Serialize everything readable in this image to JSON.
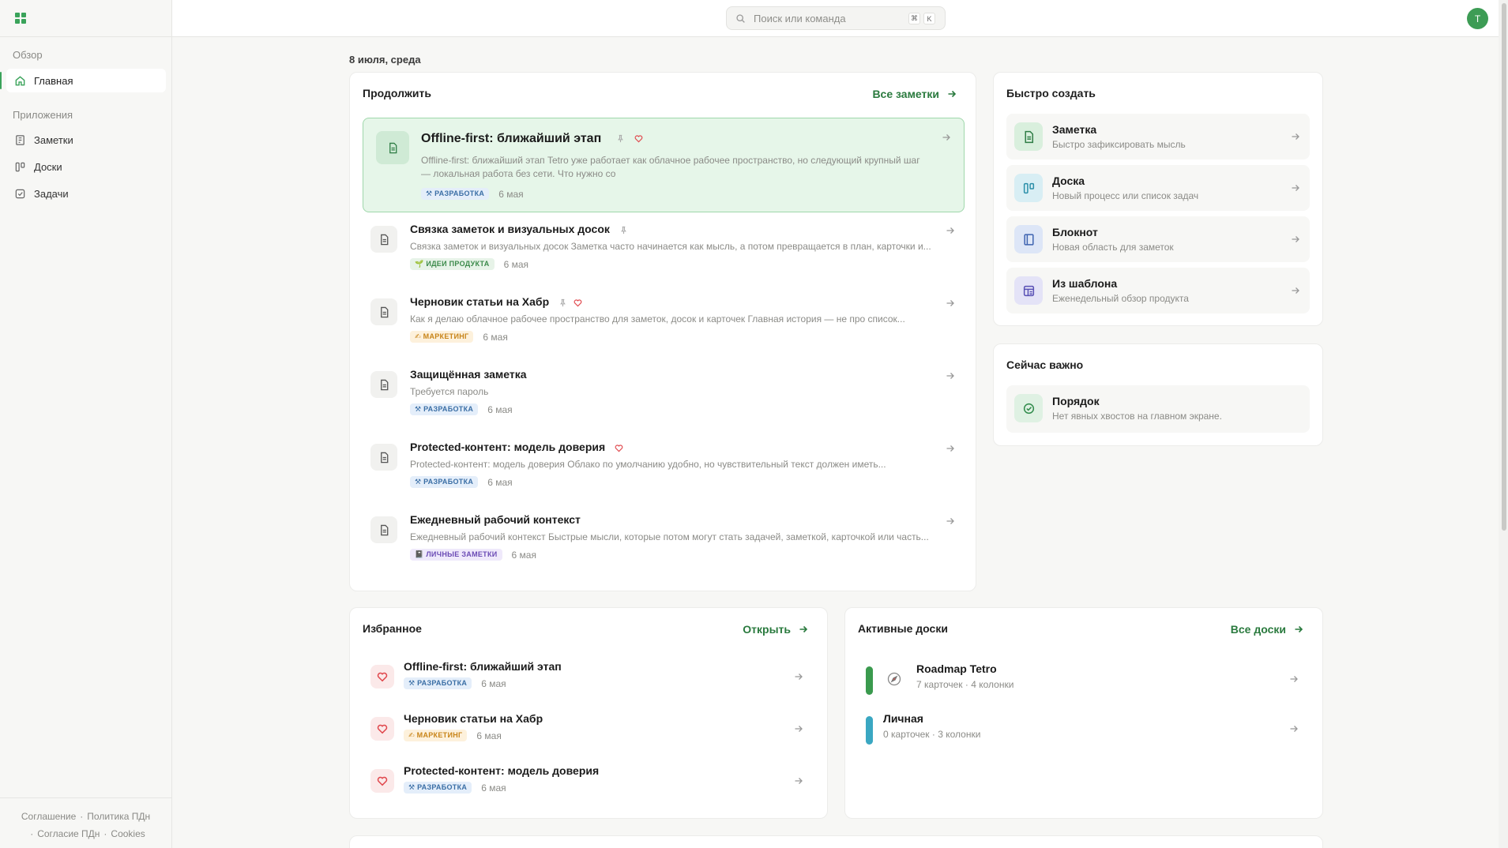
{
  "sidebar": {
    "section_overview": "Обзор",
    "home": "Главная",
    "section_apps": "Приложения",
    "notes": "Заметки",
    "boards": "Доски",
    "tasks": "Задачи",
    "footer": {
      "agreement": "Соглашение",
      "privacy": "Политика ПДн",
      "consent": "Согласие ПДн",
      "cookies": "Cookies"
    }
  },
  "topbar": {
    "search_placeholder": "Поиск или команда",
    "kbd_mod": "⌘",
    "kbd_key": "K",
    "avatar_letter": "T"
  },
  "date_label": "8 июля, среда",
  "continue": {
    "title": "Продолжить",
    "link": "Все заметки",
    "featured": {
      "title": "Offline-first: ближайший этап",
      "excerpt_line1": "Offline-first: ближайший этап Tetro уже работает как облачное рабочее пространство, но следующий крупный шаг",
      "excerpt_line2": "— локальная работа без сети. Что нужно со",
      "tag": "РАЗРАБОТКА",
      "date": "6 мая"
    },
    "items": [
      {
        "title": "Связка заметок и визуальных досок",
        "excerpt": "Связка заметок и визуальных досок Заметка часто начинается как мысль, а потом превращается в план, карточки и...",
        "tag": "ИДЕИ ПРОДУКТА",
        "tag_kind": "idea",
        "date": "6 мая"
      },
      {
        "title": "Черновик статьи на Хабр",
        "excerpt": "Как я делаю облачное рабочее пространство для заметок, досок и карточек Главная история — не про список...",
        "tag": "МАРКЕТИНГ",
        "tag_kind": "mkt",
        "date": "6 мая"
      },
      {
        "title": "Защищённая заметка",
        "excerpt": "Требуется пароль",
        "tag": "РАЗРАБОТКА",
        "tag_kind": "dev",
        "date": "6 мая"
      },
      {
        "title": "Protected-контент: модель доверия",
        "excerpt": "Protected-контент: модель доверия Облако по умолчанию удобно, но чувствительный текст должен иметь...",
        "tag": "РАЗРАБОТКА",
        "tag_kind": "dev",
        "date": "6 мая"
      },
      {
        "title": "Ежедневный рабочий контекст",
        "excerpt": "Ежедневный рабочий контекст Быстрые мысли, которые потом могут стать задачей, заметкой, карточкой или часть...",
        "tag": "ЛИЧНЫЕ ЗАМЕТКИ",
        "tag_kind": "pers",
        "date": "6 мая"
      }
    ]
  },
  "quick_create": {
    "title": "Быстро создать",
    "items": [
      {
        "title": "Заметка",
        "subtitle": "Быстро зафиксировать мысль"
      },
      {
        "title": "Доска",
        "subtitle": "Новый процесс или список задач"
      },
      {
        "title": "Блокнот",
        "subtitle": "Новая область для заметок"
      },
      {
        "title": "Из шаблона",
        "subtitle": "Еженедельный обзор продукта"
      }
    ]
  },
  "important": {
    "title": "Сейчас важно",
    "item_title": "Порядок",
    "item_subtitle": "Нет явных хвостов на главном экране."
  },
  "favorites": {
    "title": "Избранное",
    "link": "Открыть",
    "items": [
      {
        "title": "Offline-first: ближайший этап",
        "tag": "РАЗРАБОТКА",
        "tag_kind": "dev",
        "date": "6 мая"
      },
      {
        "title": "Черновик статьи на Хабр",
        "tag": "МАРКЕТИНГ",
        "tag_kind": "mkt",
        "date": "6 мая"
      },
      {
        "title": "Protected-контент: модель доверия",
        "tag": "РАЗРАБОТКА",
        "tag_kind": "dev",
        "date": "6 мая"
      }
    ]
  },
  "boards": {
    "title": "Активные доски",
    "link": "Все доски",
    "items": [
      {
        "title": "Roadmap Tetro",
        "meta": "7 карточек · 4 колонки",
        "color": "#3a9a4e"
      },
      {
        "title": "Личная",
        "meta": "0 карточек · 3 колонки",
        "color": "#3aa7c2"
      }
    ]
  },
  "colors": {
    "accent": "#3aa35a",
    "link": "#2a7a3e",
    "favorite": "#e0474c"
  }
}
